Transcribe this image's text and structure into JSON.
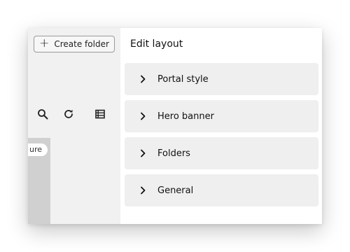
{
  "left_panel": {
    "create_folder_label": "Create folder",
    "create_folder_icon": "plus-icon",
    "toolbar_icons": [
      "search-icon",
      "refresh-icon",
      "list-view-icon"
    ],
    "card_label": "ure"
  },
  "edit_layout": {
    "title": "Edit layout",
    "sections": [
      {
        "label": "Portal style",
        "icon": "chevron-right-icon"
      },
      {
        "label": "Hero banner",
        "icon": "chevron-right-icon"
      },
      {
        "label": "Folders",
        "icon": "chevron-right-icon"
      },
      {
        "label": "General",
        "icon": "chevron-right-icon"
      }
    ]
  }
}
